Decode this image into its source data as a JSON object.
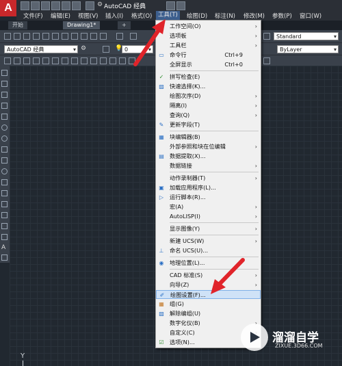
{
  "app": {
    "logo_letter": "A",
    "workspace_title": "AutoCAD 经典",
    "menubar": [
      "文件(F)",
      "编辑(E)",
      "视图(V)",
      "插入(I)",
      "格式(O)",
      "工具(T)",
      "绘图(D)",
      "标注(N)",
      "修改(M)",
      "参数(P)",
      "窗口(W)"
    ]
  },
  "tabs": [
    {
      "label": "开始"
    },
    {
      "label": "Drawing1*"
    },
    {
      "label": "+"
    }
  ],
  "ribbon": {
    "workspace_combo": "AutoCAD 经典",
    "style_combo": "Standard",
    "layer_combo": "ByLayer",
    "layer_value": "0"
  },
  "tools_menu": {
    "items": [
      {
        "label": "工作空间(O)",
        "shortcut": "",
        "submenu": true,
        "icon": ""
      },
      {
        "label": "选项板",
        "shortcut": "",
        "submenu": true,
        "icon": ""
      },
      {
        "label": "工具栏",
        "shortcut": "",
        "submenu": true,
        "icon": ""
      },
      {
        "label": "命令行",
        "shortcut": "Ctrl+9",
        "submenu": false,
        "icon": "command-line-icon"
      },
      {
        "label": "全屏显示",
        "shortcut": "Ctrl+0",
        "submenu": false,
        "icon": ""
      },
      {
        "label": "拼写检查(E)",
        "shortcut": "",
        "submenu": false,
        "icon": "spell-check-icon"
      },
      {
        "label": "快速选择(K)...",
        "shortcut": "",
        "submenu": false,
        "icon": "quick-select-icon"
      },
      {
        "label": "绘图次序(D)",
        "shortcut": "",
        "submenu": true,
        "icon": ""
      },
      {
        "label": "隔离(I)",
        "shortcut": "",
        "submenu": true,
        "icon": ""
      },
      {
        "label": "查询(Q)",
        "shortcut": "",
        "submenu": true,
        "icon": ""
      },
      {
        "label": "更新字段(T)",
        "shortcut": "",
        "submenu": false,
        "icon": "update-field-icon"
      },
      {
        "label": "块编辑器(B)",
        "shortcut": "",
        "submenu": false,
        "icon": "block-editor-icon"
      },
      {
        "label": "外部参照和块在位编辑",
        "shortcut": "",
        "submenu": true,
        "icon": ""
      },
      {
        "label": "数据提取(X)...",
        "shortcut": "",
        "submenu": false,
        "icon": "data-extraction-icon"
      },
      {
        "label": "数据链接",
        "shortcut": "",
        "submenu": true,
        "icon": ""
      },
      {
        "label": "动作录制器(T)",
        "shortcut": "",
        "submenu": true,
        "icon": ""
      },
      {
        "label": "加载应用程序(L)...",
        "shortcut": "",
        "submenu": false,
        "icon": "load-app-icon"
      },
      {
        "label": "运行脚本(R)...",
        "shortcut": "",
        "submenu": false,
        "icon": "run-script-icon"
      },
      {
        "label": "宏(A)",
        "shortcut": "",
        "submenu": true,
        "icon": ""
      },
      {
        "label": "AutoLISP(I)",
        "shortcut": "",
        "submenu": true,
        "icon": ""
      },
      {
        "label": "显示图像(Y)",
        "shortcut": "",
        "submenu": true,
        "icon": ""
      },
      {
        "label": "新建 UCS(W)",
        "shortcut": "",
        "submenu": true,
        "icon": ""
      },
      {
        "label": "命名 UCS(U)...",
        "shortcut": "",
        "submenu": false,
        "icon": "named-ucs-icon"
      },
      {
        "label": "地理位置(L)...",
        "shortcut": "",
        "submenu": false,
        "icon": "geolocation-icon"
      },
      {
        "label": "CAD 标准(S)",
        "shortcut": "",
        "submenu": true,
        "icon": ""
      },
      {
        "label": "向导(Z)",
        "shortcut": "",
        "submenu": true,
        "icon": ""
      },
      {
        "label": "绘图设置(F)...",
        "shortcut": "",
        "submenu": false,
        "icon": "drafting-settings-icon",
        "highlighted": true
      },
      {
        "label": "组(G)",
        "shortcut": "",
        "submenu": false,
        "icon": "group-icon"
      },
      {
        "label": "解除编组(U)",
        "shortcut": "",
        "submenu": false,
        "icon": "ungroup-icon"
      },
      {
        "label": "数字化仪(B)",
        "shortcut": "",
        "submenu": true,
        "icon": ""
      },
      {
        "label": "自定义(C)",
        "shortcut": "",
        "submenu": true,
        "icon": ""
      },
      {
        "label": "选项(N)...",
        "shortcut": "",
        "submenu": false,
        "icon": "options-icon"
      }
    ]
  },
  "watermark": {
    "brand": "溜溜自学",
    "url": "ZIXUE.3D66.COM"
  },
  "ucs": {
    "axis": "Y"
  },
  "colors": {
    "accent": "#e0242a",
    "menu_highlight": "#cfe2f7",
    "canvas": "#212830"
  }
}
